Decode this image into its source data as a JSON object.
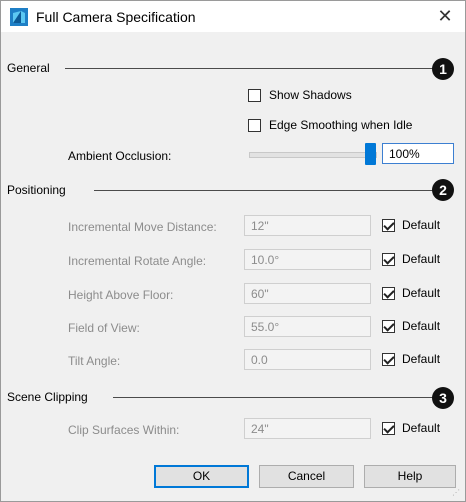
{
  "window": {
    "title": "Full Camera Specification",
    "close_glyph": "✕"
  },
  "general": {
    "label": "General",
    "badge": "1",
    "show_shadows": {
      "label": "Show Shadows",
      "checked": false
    },
    "edge_smoothing": {
      "label": "Edge Smoothing when Idle",
      "checked": false
    },
    "ambient_occlusion": {
      "label": "Ambient Occlusion:",
      "value": "100%",
      "level": 1.0
    }
  },
  "positioning": {
    "label": "Positioning",
    "badge": "2",
    "rows": [
      {
        "label": "Incremental Move Distance:",
        "value": "12\"",
        "default_label": "Default",
        "checked": true
      },
      {
        "label": "Incremental Rotate Angle:",
        "value": "10.0°",
        "default_label": "Default",
        "checked": true
      },
      {
        "label": "Height Above Floor:",
        "value": "60\"",
        "default_label": "Default",
        "checked": true
      },
      {
        "label": "Field of View:",
        "value": "55.0°",
        "default_label": "Default",
        "checked": true
      },
      {
        "label": "Tilt Angle:",
        "value": "0.0",
        "default_label": "Default",
        "checked": true
      }
    ]
  },
  "scene_clipping": {
    "label": "Scene Clipping",
    "badge": "3",
    "row": {
      "label": "Clip Surfaces Within:",
      "value": "24\"",
      "default_label": "Default",
      "checked": true
    }
  },
  "buttons": {
    "ok": "OK",
    "cancel": "Cancel",
    "help": "Help"
  },
  "colors": {
    "accent": "#0078d7",
    "disabled_text": "#8c8c8c",
    "badge": "#111111"
  }
}
